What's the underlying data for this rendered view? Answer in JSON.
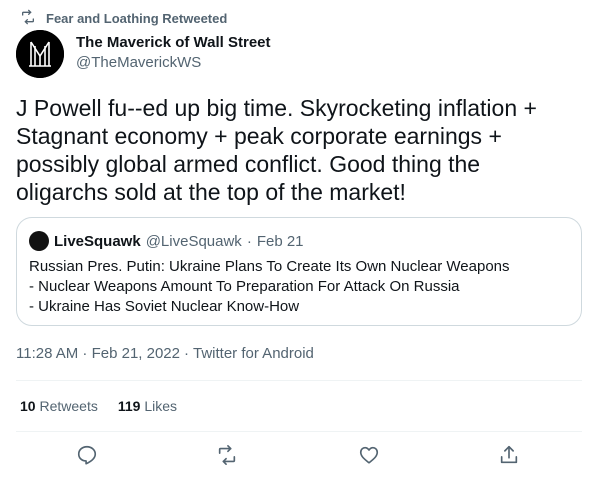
{
  "social_context": {
    "text": "Fear and Loathing Retweeted",
    "icon": "retweet-icon"
  },
  "author": {
    "display_name": "The Maverick of Wall Street",
    "handle": "@TheMaverickWS",
    "avatar_icon": "maverick-logo-icon"
  },
  "tweet": {
    "text": "J Powell fu--ed up big time. Skyrocketing inflation + Stagnant economy + peak corporate earnings + possibly global armed conflict. Good thing the oligarchs sold at the top of the market!",
    "timestamp": "11:28 AM · Feb 21, 2022",
    "separator": "·",
    "client": "Twitter for Android"
  },
  "quoted_tweet": {
    "display_name": "LiveSquawk",
    "handle": "@LiveSquawk",
    "dot": "·",
    "date": "Feb 21",
    "lines": [
      "Russian Pres. Putin: Ukraine Plans To Create Its Own Nuclear Weapons",
      "- Nuclear Weapons Amount To Preparation For Attack On Russia",
      "- Ukraine Has Soviet Nuclear Know-How"
    ]
  },
  "stats": {
    "retweets_count": "10",
    "retweets_label": "Retweets",
    "likes_count": "119",
    "likes_label": "Likes"
  },
  "actions": [
    "reply-icon",
    "retweet-icon",
    "like-icon",
    "share-icon"
  ],
  "colors": {
    "text": "#0f1419",
    "secondary": "#536471",
    "border": "#cfd9de"
  }
}
